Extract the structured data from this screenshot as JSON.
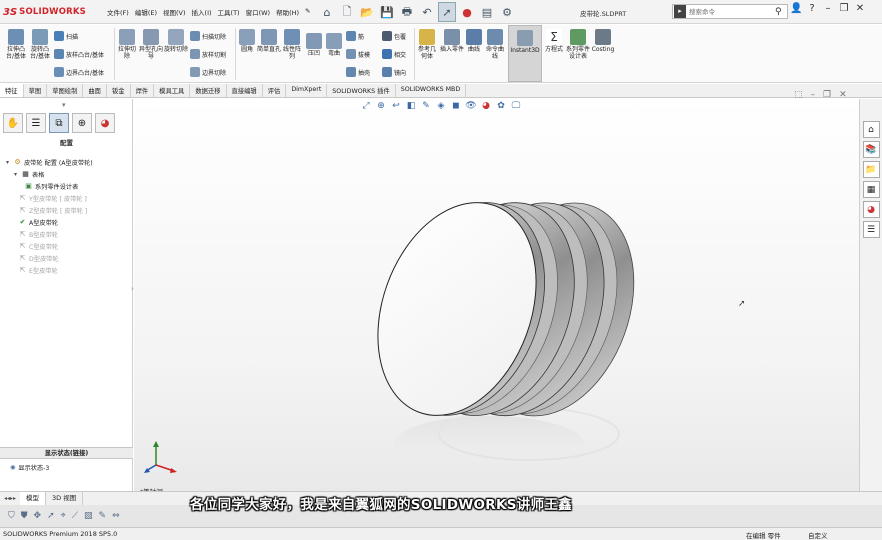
{
  "app": {
    "logo_ds": "3S",
    "logo_text": "SOLIDWORKS",
    "doc_title": "皮带轮.SLDPRT"
  },
  "menu": [
    "文件(F)",
    "编辑(E)",
    "视图(V)",
    "插入(I)",
    "工具(T)",
    "窗口(W)",
    "帮助(H)"
  ],
  "search": {
    "placeholder": "搜索命令"
  },
  "ribbon": {
    "large": [
      {
        "label": "拉伸凸台/基体",
        "icon": "extrude-boss-icon"
      },
      {
        "label": "旋转凸台/基体",
        "icon": "revolve-boss-icon"
      },
      {
        "label": "拉伸切除",
        "icon": "extrude-cut-icon"
      },
      {
        "label": "异型孔向导",
        "icon": "hole-wizard-icon"
      },
      {
        "label": "旋转切除",
        "icon": "revolve-cut-icon"
      },
      {
        "label": "圆角",
        "icon": "fillet-icon"
      },
      {
        "label": "线性阵列",
        "icon": "linear-pattern-icon"
      },
      {
        "label": "筋",
        "icon": "rib-icon"
      },
      {
        "label": "参考几何体",
        "icon": "reference-geometry-icon"
      },
      {
        "label": "曲线",
        "icon": "curves-icon"
      },
      {
        "label": "Instant3D",
        "icon": "instant3d-icon"
      },
      {
        "label": "方程式",
        "icon": "equations-icon"
      },
      {
        "label": "系列零件设计表",
        "icon": "design-table-icon"
      },
      {
        "label": "Costing",
        "icon": "costing-icon"
      }
    ],
    "small": [
      "扫描",
      "放样凸台/基体",
      "边界凸台/基体",
      "扫描切除",
      "放样切割",
      "边界切除",
      "拔模",
      "抽壳",
      "包覆",
      "相交",
      "镜向",
      "压凹",
      "弯曲",
      "简单直孔",
      "插入零件",
      "命令曲线"
    ]
  },
  "tabs": [
    "特征",
    "草图",
    "草图绘制",
    "曲面",
    "钣金",
    "焊件",
    "模具工具",
    "数据迁移",
    "直接编辑",
    "评估",
    "DimXpert",
    "SOLIDWORKS 插件",
    "SOLIDWORKS MBD"
  ],
  "left_panel": {
    "title": "配置",
    "tree": [
      {
        "label": "皮带轮 配置 (A型皮带轮)",
        "indent": 0,
        "dim": false
      },
      {
        "label": "表格",
        "indent": 1,
        "dim": false
      },
      {
        "label": "系列零件设计表",
        "indent": 2,
        "dim": false
      },
      {
        "label": "Y型皮带轮 [ 皮带轮 ]",
        "indent": 2,
        "dim": true
      },
      {
        "label": "Z型皮带轮 [ 皮带轮 ]",
        "indent": 2,
        "dim": true
      },
      {
        "label": "A型皮带轮",
        "indent": 2,
        "dim": false
      },
      {
        "label": "B型皮带轮",
        "indent": 2,
        "dim": true
      },
      {
        "label": "C型皮带轮",
        "indent": 2,
        "dim": true
      },
      {
        "label": "D型皮带轮",
        "indent": 2,
        "dim": true
      },
      {
        "label": "E型皮带轮",
        "indent": 2,
        "dim": true
      }
    ],
    "display_state_header": "显示状态(链接)",
    "display_state_item": "显示状态-3"
  },
  "viewport": {
    "view_name": "*等轴测"
  },
  "bottom_tabs": [
    "模型",
    "3D 视图"
  ],
  "subtitle": "各位同学大家好，我是来自翼狐网的SOLIDWORKS讲师王鑫",
  "status": {
    "product": "SOLIDWORKS Premium 2018 SP5.0",
    "editing": "在编辑 零件",
    "units": "自定义"
  }
}
